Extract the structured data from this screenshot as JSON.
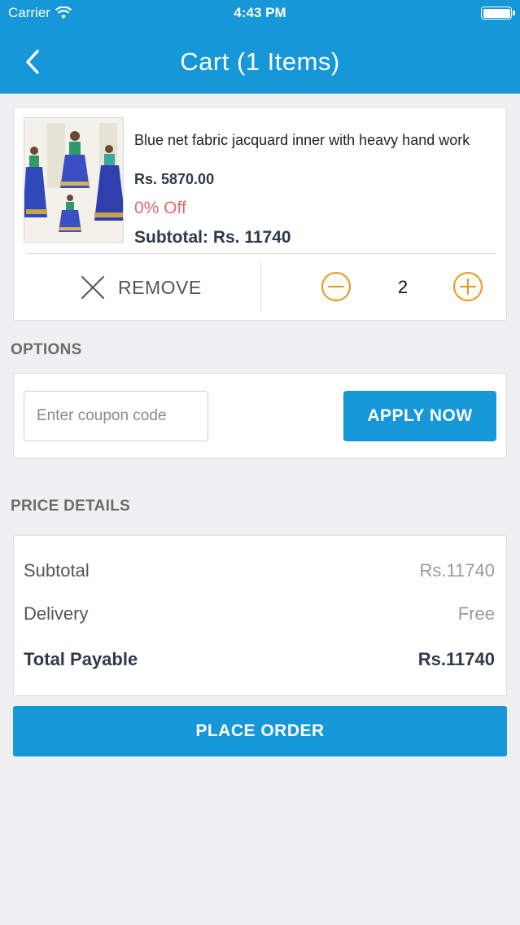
{
  "status_bar": {
    "carrier": "Carrier",
    "time": "4:43 PM"
  },
  "nav": {
    "title": "Cart (1 Items)"
  },
  "cart_item": {
    "name": "Blue net fabric jacquard inner with heavy hand work",
    "price": "Rs. 5870.00",
    "discount": "0% Off",
    "subtotal": "Subtotal: Rs. 11740",
    "remove_label": "REMOVE",
    "quantity": "2"
  },
  "options": {
    "title": "OPTIONS",
    "coupon_placeholder": "Enter coupon code",
    "apply_label": "APPLY NOW"
  },
  "price_details": {
    "title": "PRICE DETAILS",
    "rows": [
      {
        "label": "Subtotal",
        "value": "Rs.11740"
      },
      {
        "label": "Delivery",
        "value": "Free"
      },
      {
        "label": "Total Payable",
        "value": "Rs.11740"
      }
    ]
  },
  "place_order_label": "PLACE ORDER",
  "colors": {
    "primary": "#1597d8",
    "accent_orange": "#f0921e",
    "discount_red": "#e06a6a",
    "background": "#f0f0f2"
  }
}
